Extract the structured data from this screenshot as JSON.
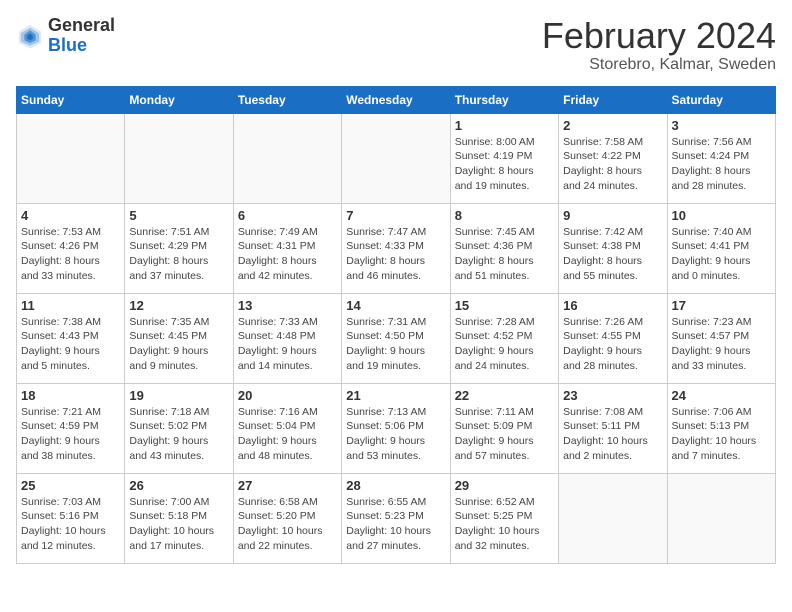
{
  "header": {
    "logo_general": "General",
    "logo_blue": "Blue",
    "month": "February 2024",
    "location": "Storebro, Kalmar, Sweden"
  },
  "weekdays": [
    "Sunday",
    "Monday",
    "Tuesday",
    "Wednesday",
    "Thursday",
    "Friday",
    "Saturday"
  ],
  "weeks": [
    [
      {
        "day": "",
        "info": ""
      },
      {
        "day": "",
        "info": ""
      },
      {
        "day": "",
        "info": ""
      },
      {
        "day": "",
        "info": ""
      },
      {
        "day": "1",
        "info": "Sunrise: 8:00 AM\nSunset: 4:19 PM\nDaylight: 8 hours\nand 19 minutes."
      },
      {
        "day": "2",
        "info": "Sunrise: 7:58 AM\nSunset: 4:22 PM\nDaylight: 8 hours\nand 24 minutes."
      },
      {
        "day": "3",
        "info": "Sunrise: 7:56 AM\nSunset: 4:24 PM\nDaylight: 8 hours\nand 28 minutes."
      }
    ],
    [
      {
        "day": "4",
        "info": "Sunrise: 7:53 AM\nSunset: 4:26 PM\nDaylight: 8 hours\nand 33 minutes."
      },
      {
        "day": "5",
        "info": "Sunrise: 7:51 AM\nSunset: 4:29 PM\nDaylight: 8 hours\nand 37 minutes."
      },
      {
        "day": "6",
        "info": "Sunrise: 7:49 AM\nSunset: 4:31 PM\nDaylight: 8 hours\nand 42 minutes."
      },
      {
        "day": "7",
        "info": "Sunrise: 7:47 AM\nSunset: 4:33 PM\nDaylight: 8 hours\nand 46 minutes."
      },
      {
        "day": "8",
        "info": "Sunrise: 7:45 AM\nSunset: 4:36 PM\nDaylight: 8 hours\nand 51 minutes."
      },
      {
        "day": "9",
        "info": "Sunrise: 7:42 AM\nSunset: 4:38 PM\nDaylight: 8 hours\nand 55 minutes."
      },
      {
        "day": "10",
        "info": "Sunrise: 7:40 AM\nSunset: 4:41 PM\nDaylight: 9 hours\nand 0 minutes."
      }
    ],
    [
      {
        "day": "11",
        "info": "Sunrise: 7:38 AM\nSunset: 4:43 PM\nDaylight: 9 hours\nand 5 minutes."
      },
      {
        "day": "12",
        "info": "Sunrise: 7:35 AM\nSunset: 4:45 PM\nDaylight: 9 hours\nand 9 minutes."
      },
      {
        "day": "13",
        "info": "Sunrise: 7:33 AM\nSunset: 4:48 PM\nDaylight: 9 hours\nand 14 minutes."
      },
      {
        "day": "14",
        "info": "Sunrise: 7:31 AM\nSunset: 4:50 PM\nDaylight: 9 hours\nand 19 minutes."
      },
      {
        "day": "15",
        "info": "Sunrise: 7:28 AM\nSunset: 4:52 PM\nDaylight: 9 hours\nand 24 minutes."
      },
      {
        "day": "16",
        "info": "Sunrise: 7:26 AM\nSunset: 4:55 PM\nDaylight: 9 hours\nand 28 minutes."
      },
      {
        "day": "17",
        "info": "Sunrise: 7:23 AM\nSunset: 4:57 PM\nDaylight: 9 hours\nand 33 minutes."
      }
    ],
    [
      {
        "day": "18",
        "info": "Sunrise: 7:21 AM\nSunset: 4:59 PM\nDaylight: 9 hours\nand 38 minutes."
      },
      {
        "day": "19",
        "info": "Sunrise: 7:18 AM\nSunset: 5:02 PM\nDaylight: 9 hours\nand 43 minutes."
      },
      {
        "day": "20",
        "info": "Sunrise: 7:16 AM\nSunset: 5:04 PM\nDaylight: 9 hours\nand 48 minutes."
      },
      {
        "day": "21",
        "info": "Sunrise: 7:13 AM\nSunset: 5:06 PM\nDaylight: 9 hours\nand 53 minutes."
      },
      {
        "day": "22",
        "info": "Sunrise: 7:11 AM\nSunset: 5:09 PM\nDaylight: 9 hours\nand 57 minutes."
      },
      {
        "day": "23",
        "info": "Sunrise: 7:08 AM\nSunset: 5:11 PM\nDaylight: 10 hours\nand 2 minutes."
      },
      {
        "day": "24",
        "info": "Sunrise: 7:06 AM\nSunset: 5:13 PM\nDaylight: 10 hours\nand 7 minutes."
      }
    ],
    [
      {
        "day": "25",
        "info": "Sunrise: 7:03 AM\nSunset: 5:16 PM\nDaylight: 10 hours\nand 12 minutes."
      },
      {
        "day": "26",
        "info": "Sunrise: 7:00 AM\nSunset: 5:18 PM\nDaylight: 10 hours\nand 17 minutes."
      },
      {
        "day": "27",
        "info": "Sunrise: 6:58 AM\nSunset: 5:20 PM\nDaylight: 10 hours\nand 22 minutes."
      },
      {
        "day": "28",
        "info": "Sunrise: 6:55 AM\nSunset: 5:23 PM\nDaylight: 10 hours\nand 27 minutes."
      },
      {
        "day": "29",
        "info": "Sunrise: 6:52 AM\nSunset: 5:25 PM\nDaylight: 10 hours\nand 32 minutes."
      },
      {
        "day": "",
        "info": ""
      },
      {
        "day": "",
        "info": ""
      }
    ]
  ]
}
